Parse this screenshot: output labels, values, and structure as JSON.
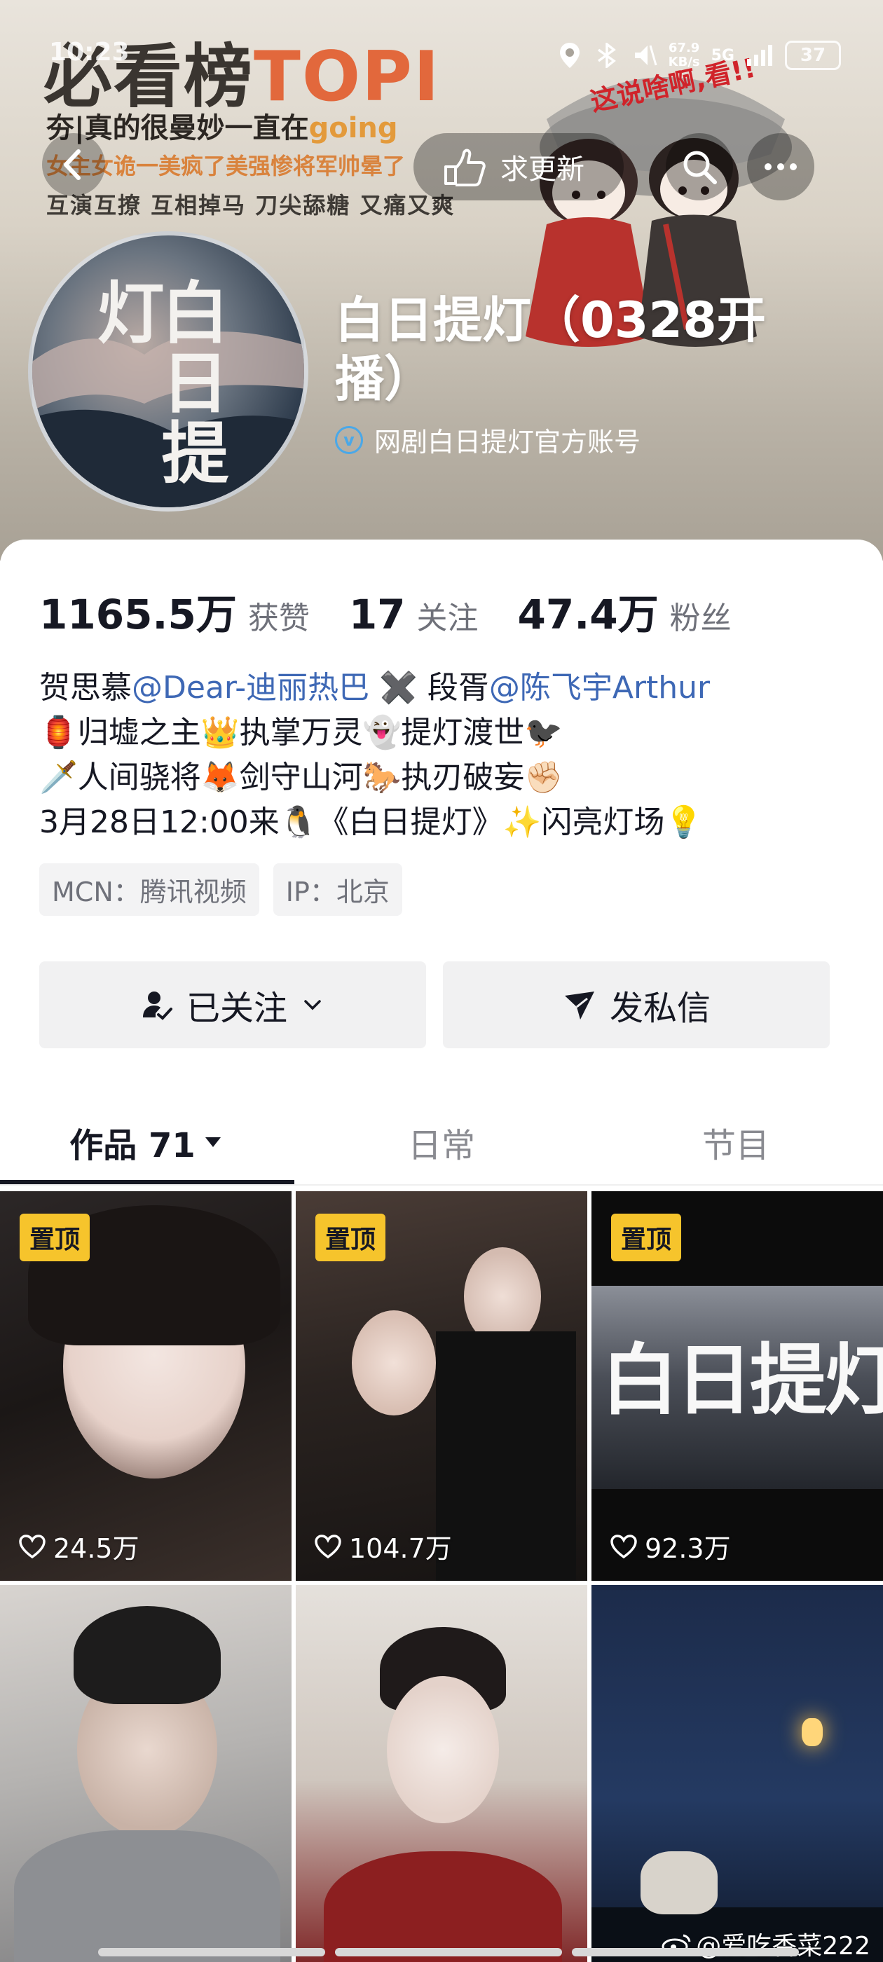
{
  "status_bar": {
    "time": "10:23",
    "speed_top": "67.9",
    "speed_bottom": "KB/s",
    "network": "5G",
    "battery": "37"
  },
  "banner": {
    "title_cn": "必看榜",
    "title_en": "TOPI",
    "line2_cn": "夯|真的很曼妙一直在",
    "line2_en": "going",
    "line3": "女主女诡一美疯了美强惨将军帅晕了",
    "line4": "互演互撩 互相掉马 刀尖舔糖 又痛又爽",
    "stamp": "这说啥啊,看!!"
  },
  "nav": {
    "update_label": "求更新"
  },
  "profile": {
    "avatar_text": "白日提灯",
    "name": "白日提灯（0328开播）",
    "verify_icon": "v",
    "verify_text": "网剧白日提灯官方账号"
  },
  "stats": {
    "likes_num": "1165.5万",
    "likes_label": "获赞",
    "following_num": "17",
    "following_label": "关注",
    "fans_num": "47.4万",
    "fans_label": "粉丝"
  },
  "bio": {
    "line1_a": "贺思慕",
    "line1_b": "@Dear-迪丽热巴",
    "line1_c": " ✖️ 段胥",
    "line1_d": "@陈飞宇Arthur",
    "line2": "🏮归墟之主👑执掌万灵👻提灯渡世🐦‍⬛",
    "line3": "🗡️人间骁将🦊剑守山河🐎执刃破妄✊🏻",
    "line4": "3月28日12:00来🐧《白日提灯》✨闪亮灯场💡"
  },
  "chips": {
    "mcn": "MCN：腾讯视频",
    "ip": "IP：北京"
  },
  "buttons": {
    "follow": "已关注",
    "message": "发私信"
  },
  "tabs": {
    "works": "作品 71",
    "daily": "日常",
    "shows": "节目"
  },
  "videos": [
    {
      "pinned": "置顶",
      "likes": "24.5万"
    },
    {
      "pinned": "置顶",
      "likes": "104.7万"
    },
    {
      "pinned": "置顶",
      "likes": "92.3万",
      "title_overlay": "白日提灯"
    },
    {
      "pinned": "",
      "likes": ""
    },
    {
      "pinned": "",
      "likes": ""
    },
    {
      "pinned": "",
      "likes": ""
    }
  ],
  "watermark": "@爱吃香菜222",
  "colors": {
    "mention": "#3e68b5",
    "pin_badge": "#f6c42c",
    "verify": "#4aa8e8"
  }
}
